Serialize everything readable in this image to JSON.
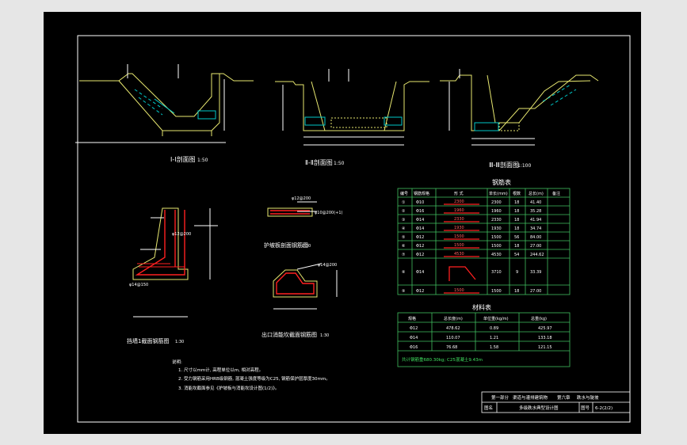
{
  "colors": {
    "frame": "#ffffff",
    "line": "#e8e870",
    "dim": "#ffffff",
    "water": "#00c8c8",
    "rebar": "#ff2020",
    "table": "#40c060",
    "cyan": "#00d0d0",
    "text": "#ffffff"
  },
  "views": {
    "s1_title": "Ⅰ-Ⅰ剖面图",
    "s1_scale": "1:50",
    "s2_title": "Ⅱ-Ⅱ剖面图",
    "s2_scale": "1:50",
    "s3_title": "Ⅲ-Ⅲ剖面图",
    "s3_scale": "1:100",
    "d1_title": "挡墙1截面钢筋图",
    "d1_scale": "1:30",
    "d2_title": "护坡板剖面钢筋图",
    "d2_scale": "1:30",
    "d3_title": "出口消能坎截面钢筋图",
    "d3_scale": "1:30",
    "tag1": "φ12@200",
    "tag2": "φ10@200(+1)",
    "tag3": "φ14@150",
    "tag4": "φ12@200",
    "tag5": "φ14@200",
    "tag6": "φ16@150"
  },
  "rebar_table": {
    "title": "钢筋表",
    "headers": [
      "编号",
      "钢筋规格",
      "形  式",
      "单长(mm)",
      "根数",
      "总长(m)",
      "备注"
    ],
    "rows": [
      {
        "no": "①",
        "spec": "Φ10",
        "shape": "2300",
        "unit": "2300",
        "count": "18",
        "total": "41.40",
        "note": ""
      },
      {
        "no": "②",
        "spec": "Φ16",
        "shape": "1960",
        "unit": "1960",
        "count": "18",
        "total": "35.28",
        "note": ""
      },
      {
        "no": "③",
        "spec": "Φ14",
        "shape": "2330",
        "unit": "2330",
        "count": "18",
        "total": "41.94",
        "note": ""
      },
      {
        "no": "④",
        "spec": "Φ14",
        "shape": "1930",
        "unit": "1930",
        "count": "18",
        "total": "34.74",
        "note": ""
      },
      {
        "no": "⑤",
        "spec": "Φ12",
        "shape": "1500",
        "unit": "1500",
        "count": "56",
        "total": "84.00",
        "note": ""
      },
      {
        "no": "⑥",
        "spec": "Φ12",
        "shape": "1500",
        "unit": "1500",
        "count": "18",
        "total": "27.00",
        "note": ""
      },
      {
        "no": "⑦",
        "spec": "Φ12",
        "shape": "4530",
        "unit": "4530",
        "count": "54",
        "total": "244.62",
        "note": ""
      },
      {
        "no": "⑧",
        "spec": "Φ14",
        "shape": "",
        "unit": "3710",
        "count": "9",
        "total": "33.39",
        "note": ""
      },
      {
        "no": "⑨",
        "spec": "Φ12",
        "shape": "1500",
        "unit": "1500",
        "count": "18",
        "total": "27.00",
        "note": ""
      }
    ]
  },
  "material_table": {
    "title": "材料表",
    "headers": [
      "规格",
      "总长度(m)",
      "单位重(kg/m)",
      "总重(kg)"
    ],
    "rows": [
      {
        "spec": "Φ12",
        "length": "478.62",
        "unit": "0.89",
        "weight": "425.97"
      },
      {
        "spec": "Φ14",
        "length": "110.07",
        "unit": "1.21",
        "weight": "133.18"
      },
      {
        "spec": "Φ16",
        "length": "76.68",
        "unit": "1.58",
        "weight": "121.15"
      }
    ],
    "summary": "共计钢筋重680.30kg; C25混凝土9.43m"
  },
  "notes": {
    "head": "说明:",
    "l1": "1. 尺寸以mm计, 高程单位以m, 相对高程。",
    "l2": "2. 受力钢筋采用HRB级钢筋, 混凝土强度等级为C25, 钢筋保护层厚度30mm。",
    "l3": "3. 消能坎截面参见《护坡板与消能坎设计图(1/2)》。"
  },
  "title_block": {
    "part": "第一部分",
    "part_name": "渠道与灌排建筑物",
    "chapter": "第六章",
    "chapter_name": "跌水与陡坡",
    "drawing_label": "图名",
    "drawing_name": "多级跌水典型设计图",
    "number_label": "图号",
    "number": "6-2(2/2)"
  }
}
